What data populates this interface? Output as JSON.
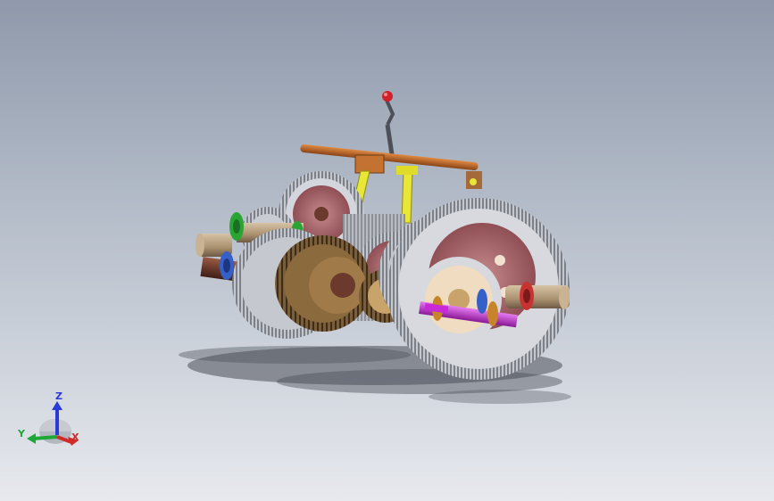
{
  "viewport": {
    "background_top": "#8f99ab",
    "background_bottom": "#e7e9ee"
  },
  "model": {
    "part_colors": {
      "gear_steel": "#b9bcc4",
      "gear_tooth": "#8f9299",
      "gear_web": "#a8656a",
      "gear_bronze": "#8b6a3d",
      "shaft": "#6b3a2c",
      "shaft_light": "#b59a7a",
      "fork_yellow": "#e8e636",
      "rail_orange": "#c06a2a",
      "bearing_green": "#2aa534",
      "bearing_blue": "#3560c8",
      "bearing_red": "#c83232",
      "pin_magenta": "#c72ad6",
      "knob_red": "#d0202a"
    }
  },
  "triad": {
    "z_label": "Z",
    "y_label": "Y",
    "x_label": "X",
    "z_color": "#2a3ad8",
    "y_color": "#1fa83a",
    "x_color": "#d02a2a"
  }
}
